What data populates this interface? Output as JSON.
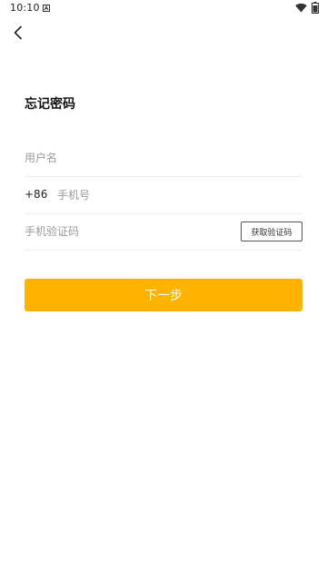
{
  "status_bar": {
    "time": "10:10",
    "notification_icon": "a-letter-icon",
    "wifi_icon": "wifi-icon",
    "battery_icon": "battery-icon"
  },
  "header": {
    "back_icon": "chevron-left-icon"
  },
  "page": {
    "title": "忘记密码"
  },
  "form": {
    "username": {
      "placeholder": "用户名",
      "value": ""
    },
    "phone": {
      "country_code": "+86",
      "placeholder": "手机号",
      "value": ""
    },
    "code": {
      "placeholder": "手机验证码",
      "value": "",
      "get_code_label": "获取验证码"
    }
  },
  "actions": {
    "next_label": "下一步"
  },
  "colors": {
    "accent": "#FFB300",
    "divider": "#ECECEC",
    "placeholder": "#9A9A9A"
  }
}
